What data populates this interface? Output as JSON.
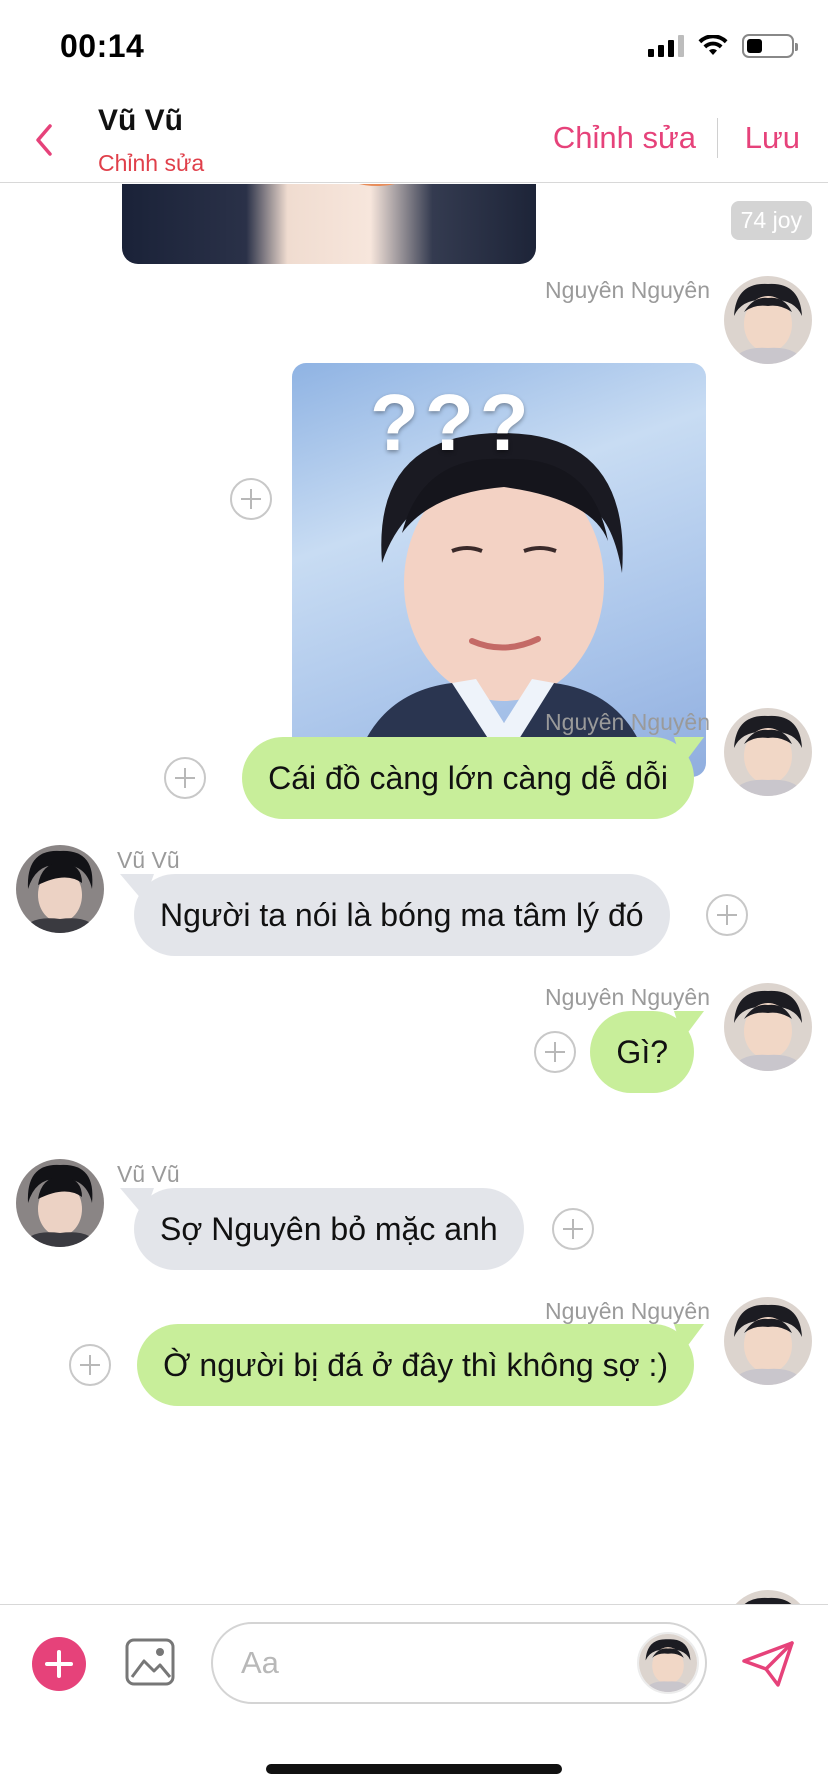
{
  "status_bar": {
    "time": "00:14",
    "battery_level": 0.35,
    "signal_icon": "signal-bars-icon",
    "wifi_icon": "wifi-icon",
    "battery_icon": "battery-icon"
  },
  "header": {
    "back_icon": "chevron-left-icon",
    "title": "Vũ Vũ",
    "subtitle": "Chỉnh sửa",
    "edit_label": "Chỉnh sửa",
    "save_label": "Lưu"
  },
  "colors": {
    "accent_pink": "#e6427a",
    "subtitle_red": "#e03f4a",
    "bubble_green": "#c8ee9a",
    "bubble_gray": "#e3e5ea"
  },
  "chat": {
    "joy_badge": "74 joy",
    "messages": [
      {
        "sender": "Nguyên Nguyên",
        "side": "right",
        "type": "image",
        "content": "???"
      },
      {
        "sender": "Nguyên Nguyên",
        "side": "right",
        "type": "text",
        "text": "Cái đồ càng lớn càng dễ dỗi"
      },
      {
        "sender": "Vũ Vũ",
        "side": "left",
        "type": "text",
        "text": "Người ta nói là bóng ma tâm lý đó"
      },
      {
        "sender": "Nguyên Nguyên",
        "side": "right",
        "type": "text",
        "text": "Gì?"
      },
      {
        "sender": "Vũ Vũ",
        "side": "left",
        "type": "text",
        "text": "Sợ Nguyên bỏ mặc anh"
      },
      {
        "sender": "Nguyên Nguyên",
        "side": "right",
        "type": "text",
        "text": "Ờ người bị đá ở đây thì không sợ :)"
      }
    ]
  },
  "composer": {
    "add_icon": "plus-circle-icon",
    "image_icon": "image-icon",
    "placeholder": "Aa",
    "value": "",
    "send_icon": "send-icon"
  }
}
